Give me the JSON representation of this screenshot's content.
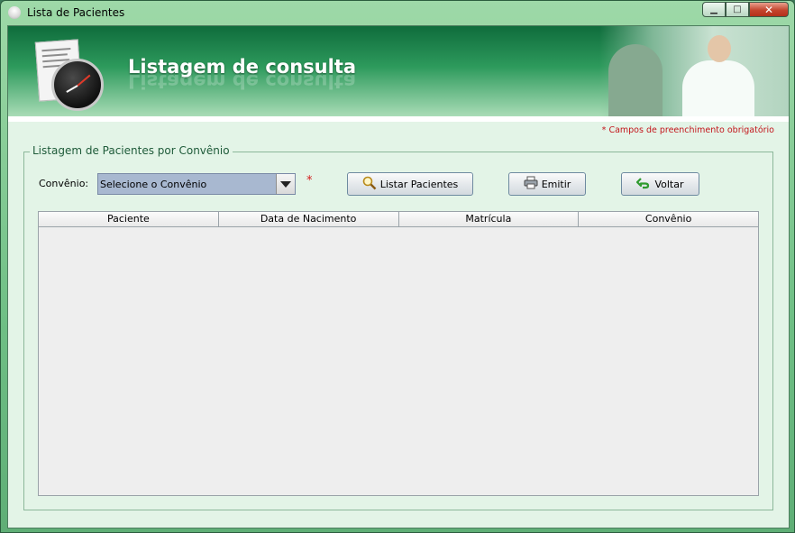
{
  "window": {
    "title": "Lista de Pacientes",
    "controls": {
      "minimize": "▁",
      "maximize": "□",
      "close": "✕"
    }
  },
  "banner": {
    "title": "Listagem de consulta"
  },
  "form": {
    "required_note": "* Campos de preenchimento obrigatório",
    "group_title": "Listagem de Pacientes por Convênio",
    "convenio_label": "Convênio:",
    "convenio_select": {
      "selected": "Selecione o Convênio"
    },
    "required_mark": "*",
    "buttons": {
      "listar": "Listar Pacientes",
      "emitir": "Emitir",
      "voltar": "Voltar"
    }
  },
  "table": {
    "columns": [
      "Paciente",
      "Data de Nacimento",
      "Matrícula",
      "Convênio"
    ],
    "rows": []
  },
  "icons": {
    "title": "app-icon",
    "listar": "magnifier-icon",
    "emitir": "printer-icon",
    "voltar": "back-arrow-icon",
    "select": "chevron-down-icon"
  },
  "colors": {
    "banner_dark": "#0f6c3c",
    "panel_bg": "#e3f4e7",
    "required_red": "#c3161c",
    "select_bg": "#a8b8d0"
  }
}
